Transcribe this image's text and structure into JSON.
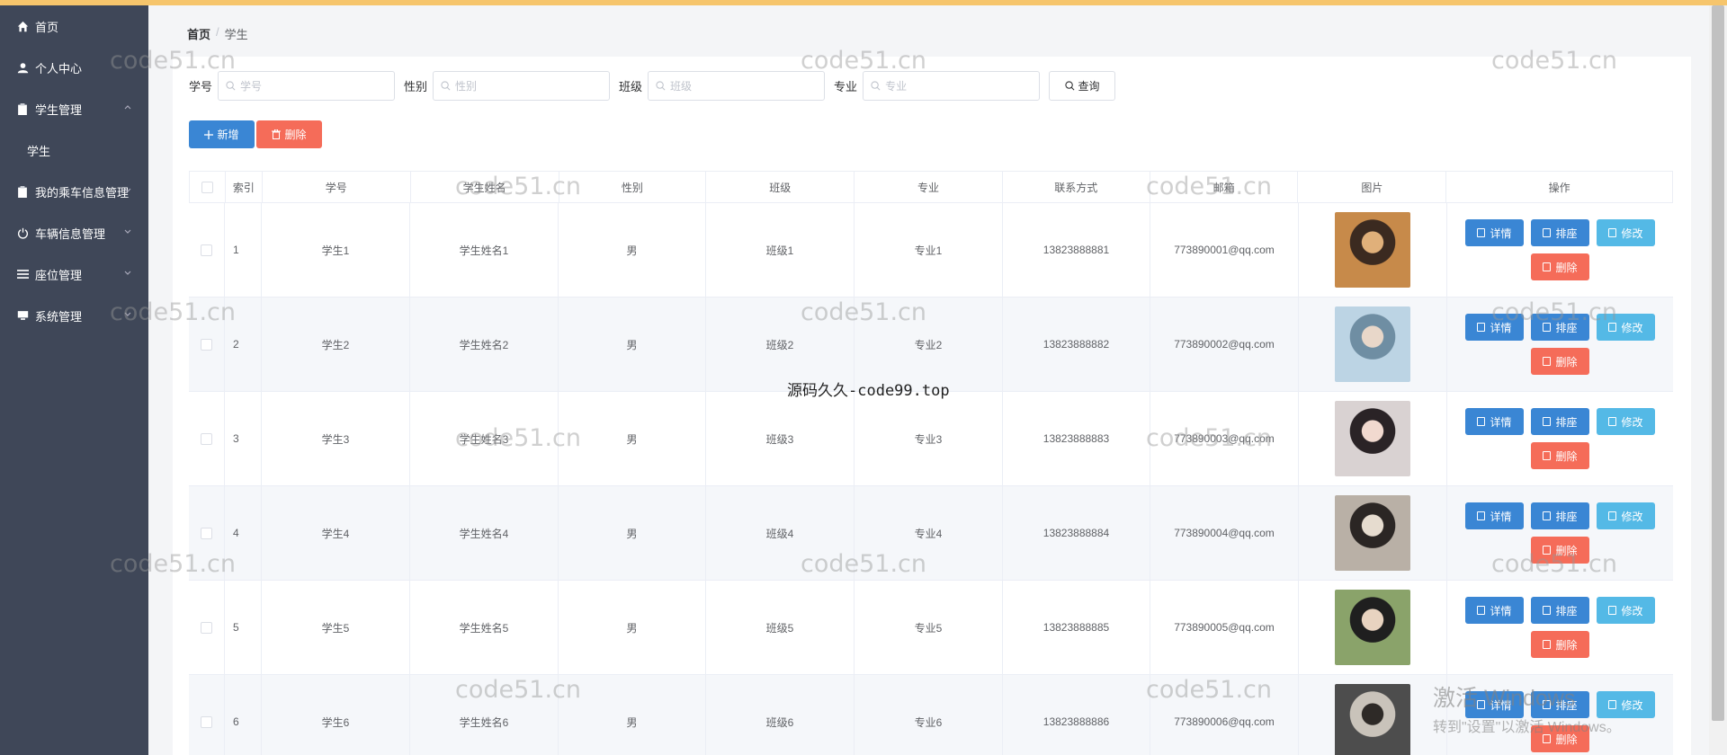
{
  "sidebar": {
    "items": [
      {
        "label": "首页",
        "icon": "home-icon"
      },
      {
        "label": "个人中心",
        "icon": "user-icon"
      },
      {
        "label": "学生管理",
        "icon": "clipboard-icon",
        "expanded": true
      },
      {
        "label": "学生",
        "sub": true
      },
      {
        "label": "我的乘车信息管理",
        "icon": "clipboard-icon"
      },
      {
        "label": "车辆信息管理",
        "icon": "power-icon"
      },
      {
        "label": "座位管理",
        "icon": "list-icon"
      },
      {
        "label": "系统管理",
        "icon": "monitor-icon"
      }
    ]
  },
  "breadcrumb": {
    "home": "首页",
    "separator": "/",
    "current": "学生"
  },
  "search": {
    "fields": [
      {
        "label": "学号",
        "placeholder": "学号"
      },
      {
        "label": "性别",
        "placeholder": "性别"
      },
      {
        "label": "班级",
        "placeholder": "班级"
      },
      {
        "label": "专业",
        "placeholder": "专业"
      }
    ],
    "query_label": "查询"
  },
  "actions": {
    "add_label": "新增",
    "delete_label": "删除"
  },
  "table": {
    "headers": [
      "索引",
      "学号",
      "学生姓名",
      "性别",
      "班级",
      "专业",
      "联系方式",
      "邮箱",
      "图片",
      "操作"
    ],
    "rows": [
      {
        "index": "1",
        "id": "学生1",
        "name": "学生姓名1",
        "gender": "男",
        "class": "班级1",
        "major": "专业1",
        "phone": "13823888881",
        "email": "773890001@qq.com"
      },
      {
        "index": "2",
        "id": "学生2",
        "name": "学生姓名2",
        "gender": "男",
        "class": "班级2",
        "major": "专业2",
        "phone": "13823888882",
        "email": "773890002@qq.com"
      },
      {
        "index": "3",
        "id": "学生3",
        "name": "学生姓名3",
        "gender": "男",
        "class": "班级3",
        "major": "专业3",
        "phone": "13823888883",
        "email": "773890003@qq.com"
      },
      {
        "index": "4",
        "id": "学生4",
        "name": "学生姓名4",
        "gender": "男",
        "class": "班级4",
        "major": "专业4",
        "phone": "13823888884",
        "email": "773890004@qq.com"
      },
      {
        "index": "5",
        "id": "学生5",
        "name": "学生姓名5",
        "gender": "男",
        "class": "班级5",
        "major": "专业5",
        "phone": "13823888885",
        "email": "773890005@qq.com"
      },
      {
        "index": "6",
        "id": "学生6",
        "name": "学生姓名6",
        "gender": "男",
        "class": "班级6",
        "major": "专业6",
        "phone": "13823888886",
        "email": "773890006@qq.com"
      }
    ],
    "ops": {
      "detail": "详情",
      "rank": "排座",
      "edit": "修改",
      "delete": "删除"
    }
  },
  "watermarks": {
    "site": "code51.cn",
    "center": "源码久久-code99.top",
    "windows_line1": "激活 Windows",
    "windows_line2": "转到\"设置\"以激活 Windows。"
  },
  "colors": {
    "sidebar_bg": "#3f4758",
    "primary": "#3a86d4",
    "danger": "#f56c59",
    "info": "#54b9e6",
    "topbar": "#f6c56c"
  }
}
